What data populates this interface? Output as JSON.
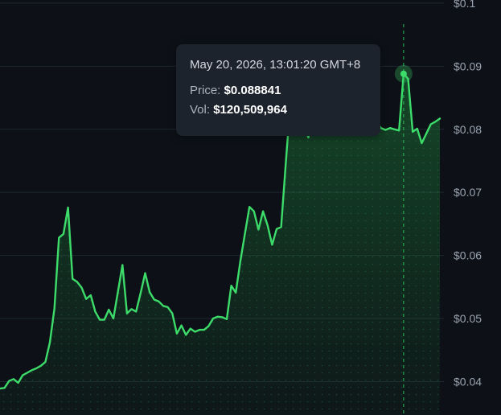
{
  "tooltip": {
    "date": "May 20, 2026, 13:01:20 GMT+8",
    "price_label": "Price:",
    "price_value": "$0.088841",
    "vol_label": "Vol:",
    "vol_value": "$120,509,964"
  },
  "colors": {
    "background": "#0d1117",
    "line": "#3ddc6a",
    "grid": "#1f2731",
    "tooltip_bg": "#1c232d",
    "tick_text": "#9aa4b1"
  },
  "chart_data": {
    "type": "area",
    "title": "",
    "xlabel": "",
    "ylabel": "",
    "ylim": [
      0.0347,
      0.1005
    ],
    "yticks": [
      0.04,
      0.05,
      0.06,
      0.07,
      0.08,
      0.09,
      0.1
    ],
    "ytick_labels": [
      "$0.04",
      "$0.05",
      "$0.06",
      "$0.07",
      "$0.08",
      "$0.09",
      "$0.1"
    ],
    "grid": true,
    "highlight_index": 89,
    "series": [
      {
        "values": [
          0.0389,
          0.039,
          0.0401,
          0.0404,
          0.0398,
          0.041,
          0.0414,
          0.0418,
          0.0421,
          0.0425,
          0.0431,
          0.0462,
          0.0516,
          0.0628,
          0.0634,
          0.0676,
          0.0563,
          0.0558,
          0.0549,
          0.0531,
          0.0537,
          0.0511,
          0.0498,
          0.0498,
          0.0514,
          0.05,
          0.0542,
          0.0585,
          0.0508,
          0.0515,
          0.0511,
          0.054,
          0.0572,
          0.0542,
          0.053,
          0.0527,
          0.052,
          0.0518,
          0.0508,
          0.0476,
          0.0489,
          0.0474,
          0.0484,
          0.0479,
          0.0482,
          0.0482,
          0.0488,
          0.05,
          0.0503,
          0.0502,
          0.0499,
          0.0552,
          0.0541,
          0.0591,
          0.0634,
          0.0677,
          0.067,
          0.0641,
          0.067,
          0.0648,
          0.0617,
          0.0642,
          0.0645,
          0.0745,
          0.084,
          0.0895,
          0.083,
          0.0808,
          0.0787,
          0.0835,
          0.0825,
          0.0832,
          0.0818,
          0.0808,
          0.0798,
          0.0801,
          0.0796,
          0.08,
          0.0802,
          0.0803,
          0.0799,
          0.0805,
          0.081,
          0.0812,
          0.0802,
          0.0799,
          0.0802,
          0.08,
          0.0798,
          0.0888,
          0.088,
          0.0796,
          0.0801,
          0.0778,
          0.0793,
          0.0808,
          0.0812,
          0.0817
        ]
      }
    ]
  }
}
